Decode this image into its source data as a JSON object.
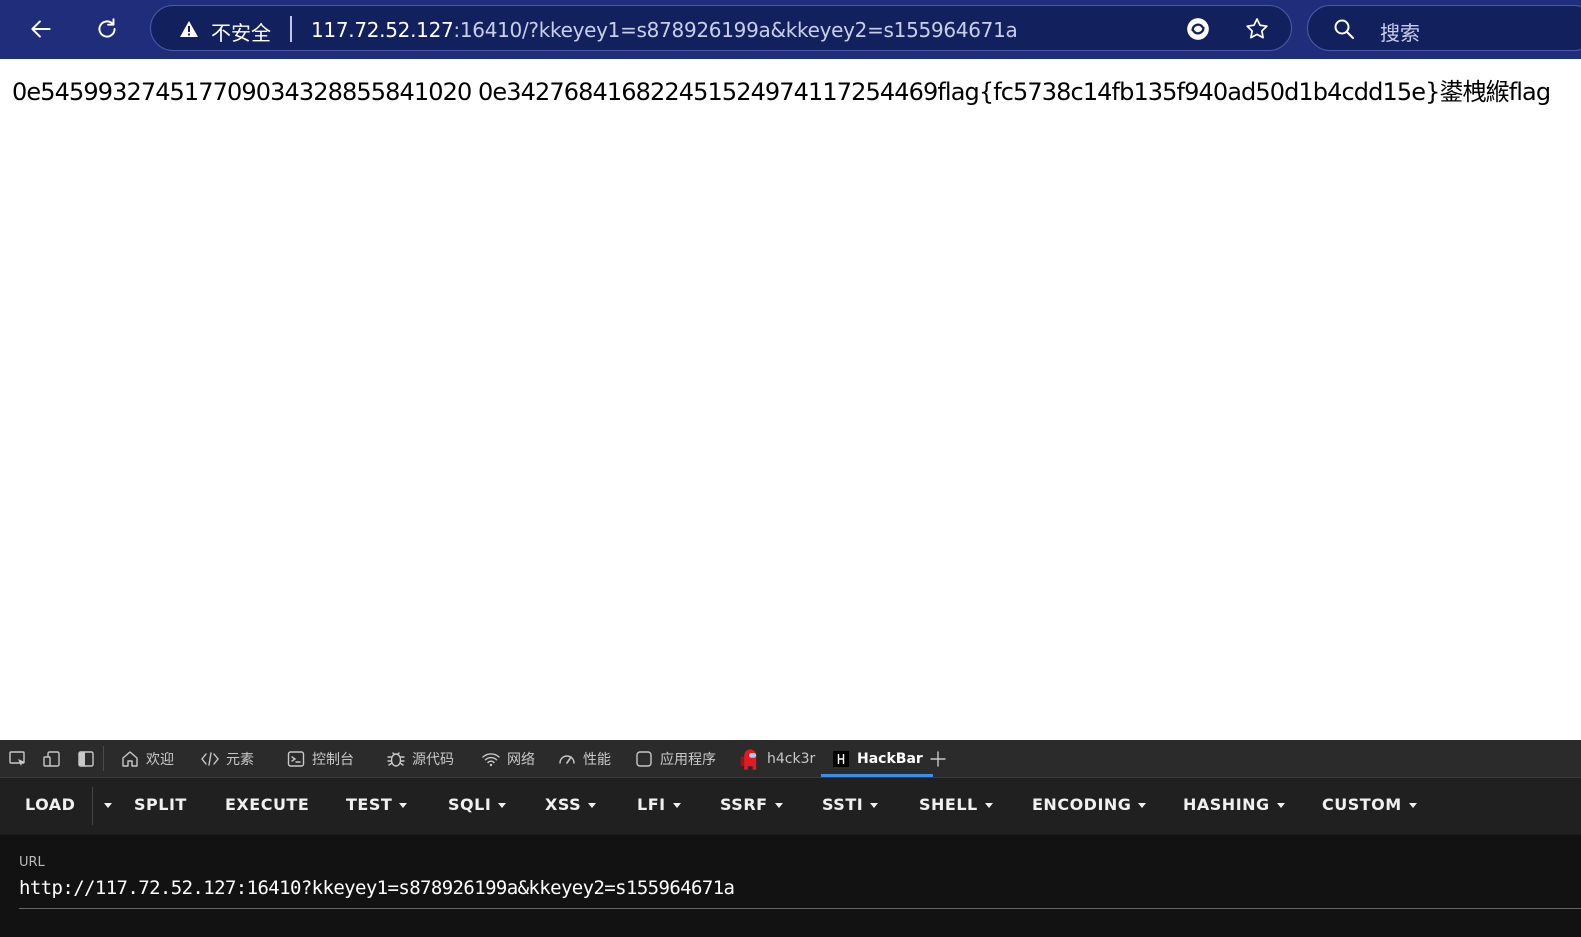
{
  "browser": {
    "security_label": "不安全",
    "url_host": "117.72.52.127",
    "url_rest": ":16410/?kkeyey1=s878926199a&kkeyey2=s155964671a",
    "search_placeholder": "搜索"
  },
  "page": {
    "body_text": "0e545993274517709034328855841020 0e342768416822451524974117254469flag{fc5738c14fb135f940ad50d1b4cdd15e}鍙栧緱flag"
  },
  "devtools": {
    "tabs": [
      {
        "label": "欢迎",
        "icon": "home-icon"
      },
      {
        "label": "元素",
        "icon": "code-icon"
      },
      {
        "label": "控制台",
        "icon": "console-icon"
      },
      {
        "label": "源代码",
        "icon": "bug-icon"
      },
      {
        "label": "网络",
        "icon": "wifi-icon"
      },
      {
        "label": "性能",
        "icon": "gauge-icon"
      },
      {
        "label": "应用程序",
        "icon": "app-icon"
      },
      {
        "label": "h4ck3r",
        "icon": "crewmate-icon"
      },
      {
        "label": "HackBar",
        "icon": "hackbar-icon"
      }
    ],
    "active_tab": "HackBar"
  },
  "hackbar": {
    "buttons": [
      "LOAD",
      "SPLIT",
      "EXECUTE",
      "TEST",
      "SQLI",
      "XSS",
      "LFI",
      "SSRF",
      "SSTI",
      "SHELL",
      "ENCODING",
      "HASHING",
      "CUSTOM"
    ],
    "url_label": "URL",
    "url_value": "http://117.72.52.127:16410?kkeyey1=s878926199a&kkeyey2=s155964671a"
  }
}
